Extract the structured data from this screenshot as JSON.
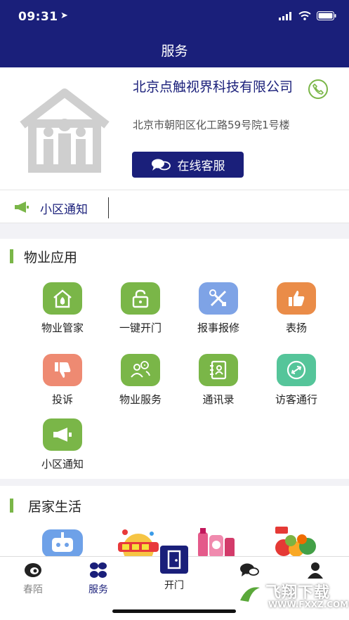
{
  "status": {
    "time": "09:31"
  },
  "header": {
    "title": "服务"
  },
  "company": {
    "name": "北京点触视界科技有限公司",
    "address": "北京市朝阳区化工路59号院1号楼",
    "service_button": "在线客服"
  },
  "notice": {
    "label": "小区通知"
  },
  "property": {
    "title": "物业应用",
    "items": [
      {
        "label": "物业管家",
        "icon": "house-shield-icon",
        "color": "#7ab648"
      },
      {
        "label": "一键开门",
        "icon": "unlock-icon",
        "color": "#7ab648"
      },
      {
        "label": "报事报修",
        "icon": "tools-icon",
        "color": "#7ea3e6"
      },
      {
        "label": "表扬",
        "icon": "thumbs-up-icon",
        "color": "#ea8c48"
      },
      {
        "label": "投诉",
        "icon": "thumbs-down-icon",
        "color": "#ee8a72"
      },
      {
        "label": "物业服务",
        "icon": "people-service-icon",
        "color": "#7ab648"
      },
      {
        "label": "通讯录",
        "icon": "contacts-icon",
        "color": "#7ab648"
      },
      {
        "label": "访客通行",
        "icon": "visitor-pass-icon",
        "color": "#55c59a"
      },
      {
        "label": "小区通知",
        "icon": "megaphone-icon",
        "color": "#7ab648"
      }
    ]
  },
  "life": {
    "title": "居家生活",
    "items": [
      {
        "icon": "robot-icon"
      },
      {
        "icon": "points-exchange-banner"
      },
      {
        "icon": "detergent-products-image"
      },
      {
        "icon": "fruits-vegetables-image"
      }
    ]
  },
  "tabbar": {
    "tabs": [
      {
        "label": "春陌",
        "icon": "brand-logo-icon"
      },
      {
        "label": "服务",
        "icon": "grid-flower-icon",
        "active": true
      },
      {
        "label": "开门",
        "icon": "door-icon"
      },
      {
        "label": "",
        "icon": "chat-icon"
      },
      {
        "label": "",
        "icon": "user-icon"
      }
    ]
  },
  "watermark": {
    "text": "飞翔下载",
    "url": "WWW.FXXZ.COM"
  },
  "colors": {
    "primary": "#1a1f7a",
    "accent": "#7ab648",
    "background": "#f2f2f6"
  }
}
